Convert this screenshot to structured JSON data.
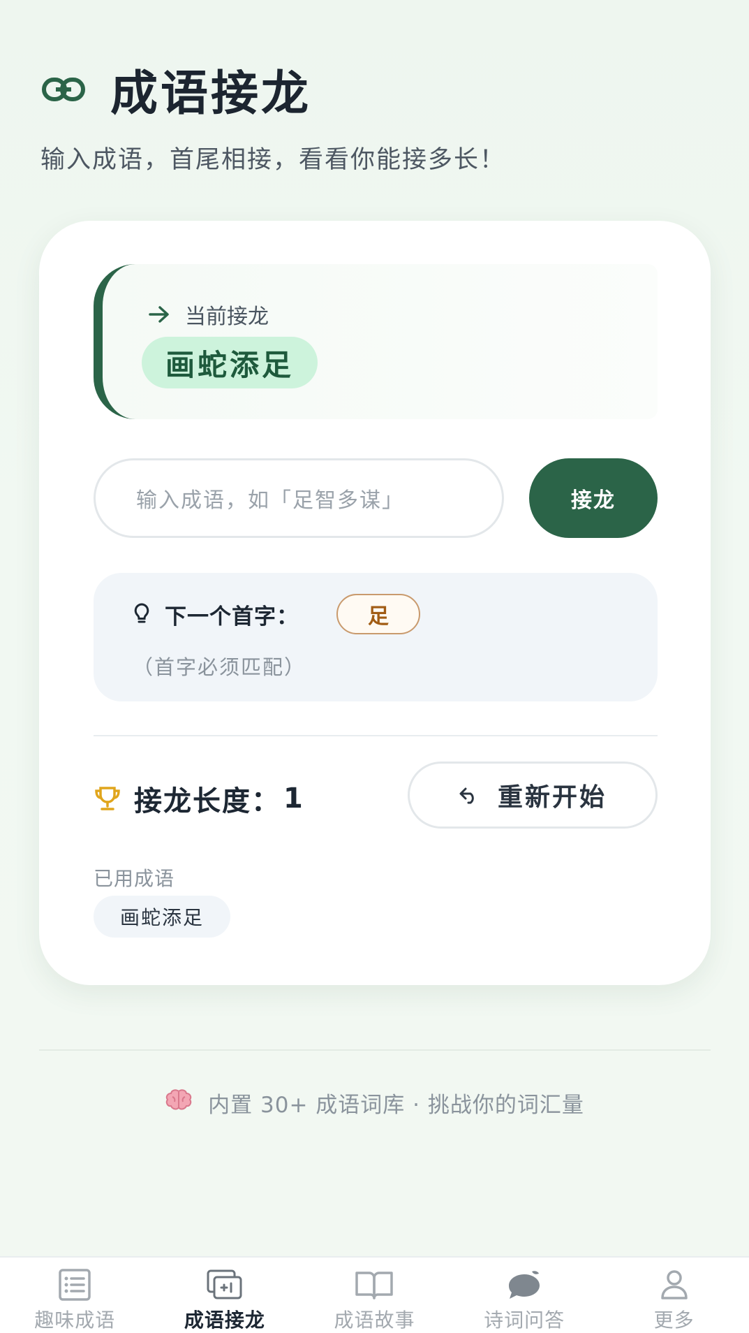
{
  "header": {
    "title": "成语接龙",
    "subtitle": "输入成语，首尾相接，看看你能接多长！",
    "icon": "link-icon"
  },
  "current": {
    "label": "当前接龙",
    "idiom": "画蛇添足"
  },
  "input": {
    "placeholder": "输入成语，如「足智多谋」",
    "value": ""
  },
  "submit_label": "接龙",
  "hint": {
    "title": "下一个首字：",
    "next_char": "足",
    "note": "（首字必须匹配）"
  },
  "stats": {
    "length_label": "接龙长度：",
    "length_value": "1",
    "restart_label": "重新开始"
  },
  "used": {
    "label": "已用成语",
    "items": [
      "画蛇添足"
    ]
  },
  "footer": {
    "text": "内置 30+ 成语词库 · 挑战你的词汇量"
  },
  "tabs": [
    {
      "label": "趣味成语",
      "icon": "list-icon",
      "active": false
    },
    {
      "label": "成语接龙",
      "icon": "chain-plus-icon",
      "active": true
    },
    {
      "label": "成语故事",
      "icon": "book-icon",
      "active": false
    },
    {
      "label": "诗词问答",
      "icon": "chat-leaf-icon",
      "active": false
    },
    {
      "label": "更多",
      "icon": "user-icon",
      "active": false
    }
  ],
  "colors": {
    "accent": "#2b6448",
    "pill_bg": "#cdf3dc",
    "hint_char": "#a15c14",
    "trophy": "#e0a51c"
  }
}
